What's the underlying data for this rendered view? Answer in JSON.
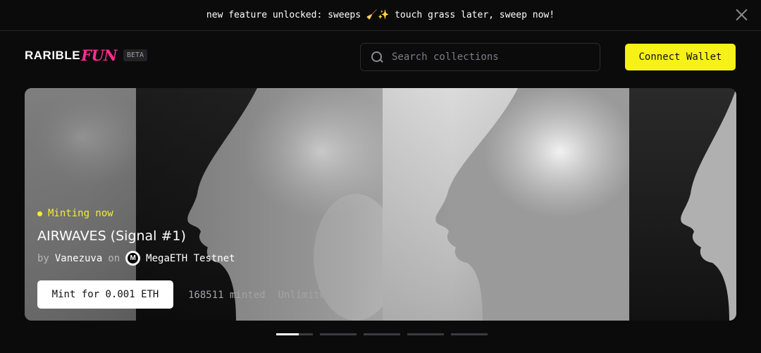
{
  "announcement": {
    "text": "new feature unlocked: sweeps 🧹✨ touch grass later, sweep now!"
  },
  "header": {
    "logo_main": "RARIBLE",
    "logo_accent": "FUN",
    "badge": "BETA",
    "search_placeholder": "Search collections",
    "connect_label": "Connect Wallet"
  },
  "hero": {
    "status": "Minting now",
    "title": "AIRWAVES (Signal #1)",
    "by": "by",
    "creator": "Vanezuva",
    "on": "on",
    "chain_icon_letter": "M",
    "chain": "MegaETH Testnet",
    "mint_label": "Mint for 0.001 ETH",
    "minted": "168511 minted",
    "supply": "Unlimited"
  },
  "carousel": {
    "count": 5,
    "active_index": 0,
    "active_progress": 0.6
  },
  "colors": {
    "accent_yellow": "#f6f116",
    "logo_pink": "#ff2e8f",
    "background": "#0b0b0c"
  }
}
